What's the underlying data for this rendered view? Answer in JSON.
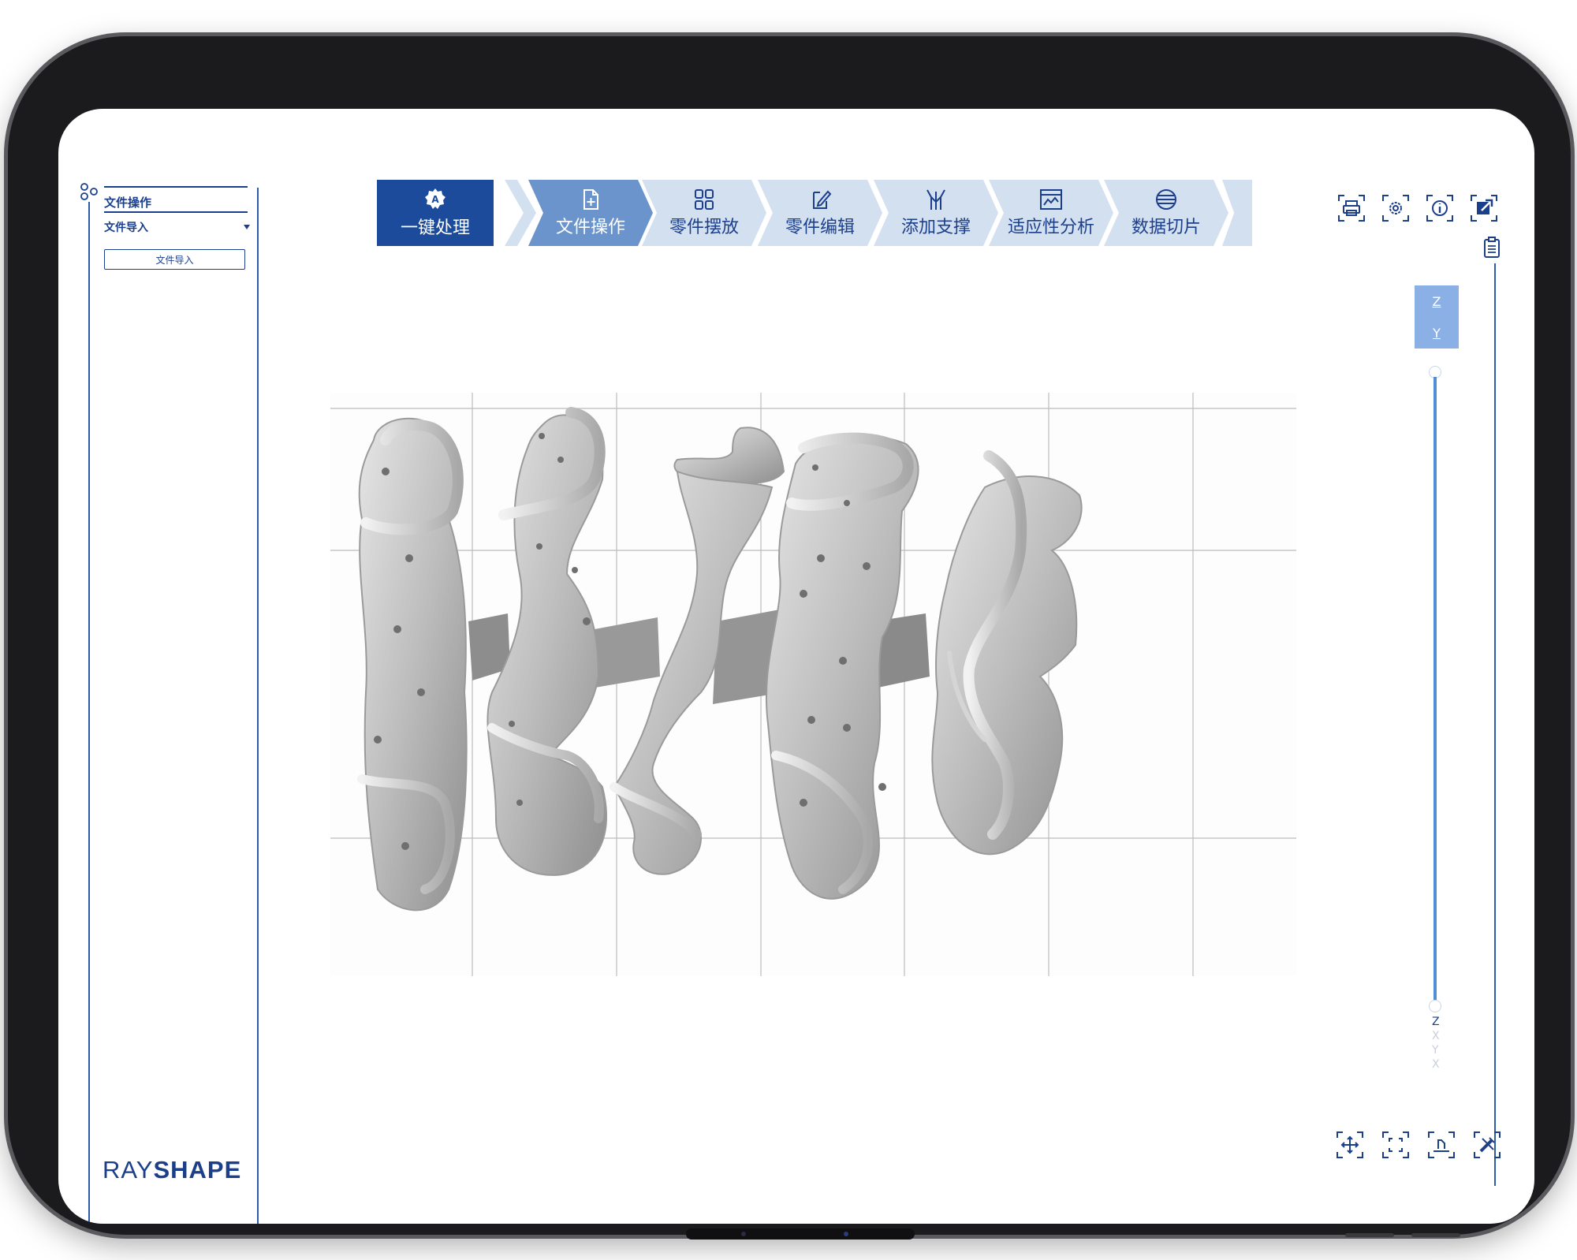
{
  "left_panel": {
    "section_title": "文件操作",
    "select_value": "文件导入",
    "action_button": "文件导入"
  },
  "brand": {
    "part1": "RAY",
    "part2": "SHAPE"
  },
  "toolbar": {
    "primary": {
      "label": "一键处理",
      "icon": "auto-process-icon"
    },
    "steps": [
      {
        "label": "文件操作",
        "icon": "file-add-icon",
        "active": true
      },
      {
        "label": "零件摆放",
        "icon": "grid-icon",
        "active": false
      },
      {
        "label": "零件编辑",
        "icon": "edit-document-icon",
        "active": false
      },
      {
        "label": "添加支撑",
        "icon": "support-icon",
        "active": false
      },
      {
        "label": "适应性分析",
        "icon": "analysis-chart-icon",
        "active": false
      },
      {
        "label": "数据切片",
        "icon": "layers-slice-icon",
        "active": false
      }
    ]
  },
  "top_tools": [
    "print-icon",
    "settings-icon",
    "info-icon",
    "export-icon"
  ],
  "side_tool": "clipboard-list-icon",
  "axis_buttons": [
    "Z",
    "Y"
  ],
  "axis_letters": [
    "Z",
    "X",
    "Y",
    "X"
  ],
  "bottom_tools": [
    "move-icon",
    "fit-view-icon",
    "place-on-bed-icon",
    "tools-icon"
  ],
  "colors": {
    "brand_blue": "#1c4b9c",
    "step_bg": "#d3e0f0",
    "step_active": "#6a94cb",
    "slider": "#4f8fd6",
    "model_gray": "#c9c9c9"
  }
}
